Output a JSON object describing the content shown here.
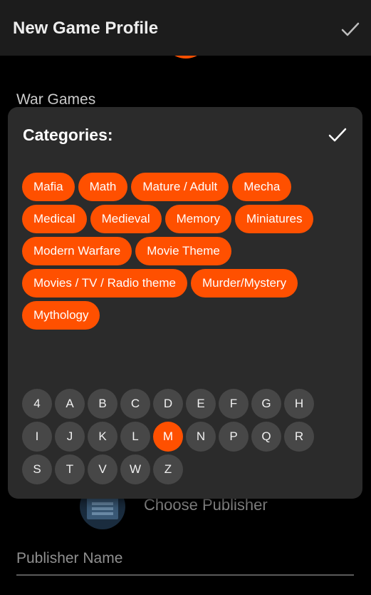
{
  "header": {
    "title": "New Game Profile",
    "confirm_icon": "check-icon"
  },
  "background": {
    "category_preview": "War Games",
    "choose_publisher": "Choose Publisher",
    "publisher_name_placeholder": "Publisher Name",
    "publisher_icon": "book-icon"
  },
  "dialog": {
    "title": "Categories:",
    "confirm_icon": "check-icon",
    "categories": [
      "Mafia",
      "Math",
      "Mature / Adult",
      "Mecha",
      "Medical",
      "Medieval",
      "Memory",
      "Miniatures",
      "Modern Warfare",
      "Movie Theme",
      "Movies / TV / Radio theme",
      "Murder/Mystery",
      "Mythology"
    ],
    "letter_rows": [
      [
        "4",
        "A",
        "B",
        "C",
        "D",
        "E",
        "F",
        "G",
        "H"
      ],
      [
        "I",
        "J",
        "K",
        "L",
        "M",
        "N",
        "P",
        "Q",
        "R"
      ],
      [
        "S",
        "T",
        "V",
        "W",
        "Z"
      ]
    ],
    "selected_letter": "M"
  },
  "colors": {
    "accent": "#ff5000",
    "topbar": "#1c1c1c",
    "dialog": "#2b2b2b",
    "letter_button": "#474747"
  }
}
